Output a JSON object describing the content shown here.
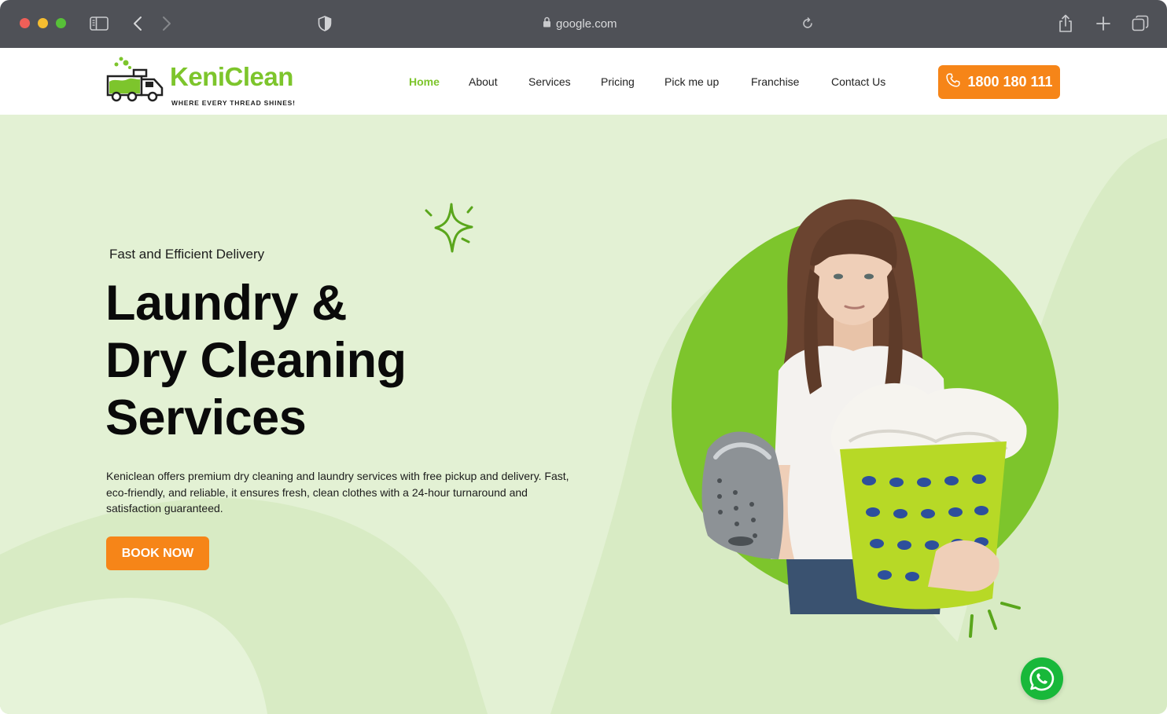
{
  "browser": {
    "url": "google.com",
    "icons": [
      "sidebar-icon",
      "back-icon",
      "forward-icon",
      "shield-icon",
      "lock-icon",
      "reload-icon",
      "share-icon",
      "new-tab-icon",
      "tabs-icon"
    ]
  },
  "header": {
    "logo": {
      "name": "KeniClean",
      "tagline": "WHERE EVERY THREAD SHINES!"
    },
    "nav": [
      {
        "label": "Home",
        "active": true
      },
      {
        "label": "About",
        "active": false
      },
      {
        "label": "Services",
        "active": false
      },
      {
        "label": "Pricing",
        "active": false
      },
      {
        "label": "Pick me up",
        "active": false
      },
      {
        "label": "Franchise",
        "active": false
      },
      {
        "label": "Contact Us",
        "active": false
      }
    ],
    "phone": {
      "label": "1800 180 111",
      "icon": "phone-icon"
    }
  },
  "hero": {
    "eyebrow": "Fast and Efficient Delivery",
    "headline": [
      "Laundry &",
      "Dry Cleaning",
      "Services"
    ],
    "description": "Keniclean offers premium dry cleaning and laundry services with free pickup and delivery. Fast, eco-friendly, and reliable, it ensures fresh, clean clothes with a 24-hour turnaround and satisfaction guaranteed.",
    "cta": "BOOK NOW"
  },
  "floating": {
    "icon": "whatsapp-icon"
  },
  "colors": {
    "brand_green": "#7dc52c",
    "accent_orange": "#f68518",
    "hero_bg": "#e3f1d4",
    "toolbar": "#4f5157",
    "whatsapp": "#18b83a"
  }
}
